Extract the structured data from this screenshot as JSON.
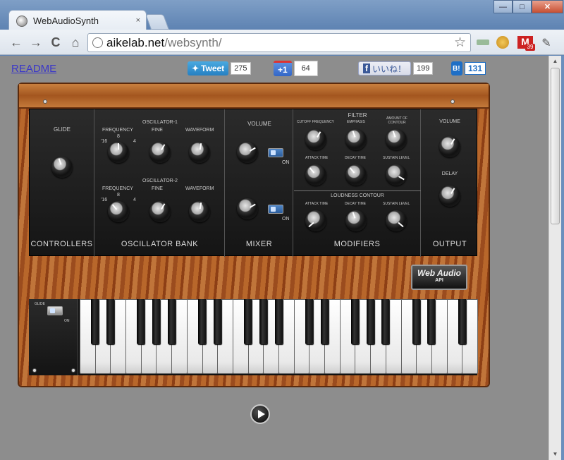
{
  "browser": {
    "tab_title": "WebAudioSynth",
    "tab_close": "×",
    "url_host": "aikelab.net",
    "url_path": "/websynth/",
    "win_min": "—",
    "win_max": "□",
    "win_close": "✕",
    "back": "←",
    "forward": "→",
    "reload": "C",
    "home": "⌂",
    "star": "☆",
    "gmail_count": "39"
  },
  "page": {
    "readme": "README",
    "tweet_label": "Tweet",
    "tweet_count": "275",
    "plusone_label": "+1",
    "plusone_count": "64",
    "like_label": "いいね！",
    "like_count": "199",
    "hatena_label": "B!",
    "hatena_count": "131"
  },
  "synth": {
    "controllers": {
      "title": "CONTROLLERS",
      "glide": "GLIDE"
    },
    "osc_bank": {
      "title": "OSCILLATOR BANK",
      "osc1": "OSCILLATOR-1",
      "osc2": "OSCILLATOR-2",
      "frequency": "FREQUENCY",
      "fine": "FINE",
      "waveform": "WAVEFORM",
      "freq_low": "'16",
      "freq_mid": "8",
      "freq_high": "4"
    },
    "mixer": {
      "title": "MIXER",
      "volume": "VOLUME",
      "on": "ON"
    },
    "modifiers": {
      "title": "MODIFIERS",
      "filter": "FILTER",
      "cutoff": "CUTOFF FREQUENCY",
      "emphasis": "EMPHASIS",
      "amount": "AMOUNT OF CONTOUR",
      "attack": "ATTACK TIME",
      "decay": "DECAY TIME",
      "sustain": "SUSTAIN LEVEL",
      "loudness": "LOUDNESS CONTOUR"
    },
    "output": {
      "title": "OUTPUT",
      "volume": "VOLUME",
      "delay": "DELAY"
    },
    "badge_main": "Web Audio",
    "badge_sub": "API",
    "keybed_glide": "GLIDE",
    "keybed_on": "ON"
  },
  "colors": {
    "panel": "#1b1b1b",
    "wood": "#a3561f",
    "toggle": "#3a70b5",
    "link": "#3a36c9"
  }
}
